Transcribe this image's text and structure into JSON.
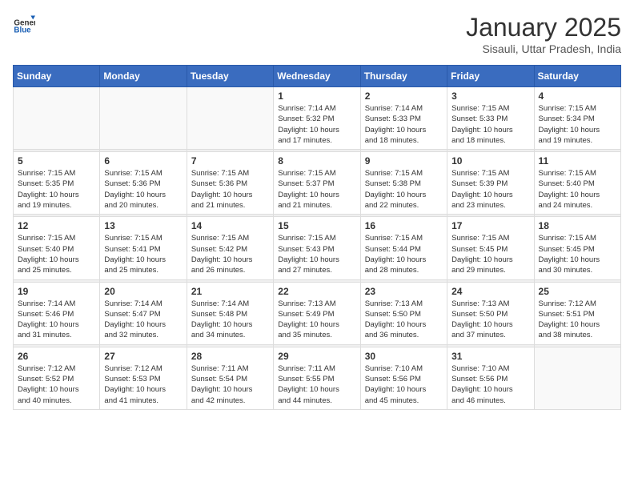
{
  "logo": {
    "text_general": "General",
    "text_blue": "Blue"
  },
  "header": {
    "title": "January 2025",
    "subtitle": "Sisauli, Uttar Pradesh, India"
  },
  "weekdays": [
    "Sunday",
    "Monday",
    "Tuesday",
    "Wednesday",
    "Thursday",
    "Friday",
    "Saturday"
  ],
  "weeks": [
    [
      {
        "day": "",
        "info": ""
      },
      {
        "day": "",
        "info": ""
      },
      {
        "day": "",
        "info": ""
      },
      {
        "day": "1",
        "info": "Sunrise: 7:14 AM\nSunset: 5:32 PM\nDaylight: 10 hours\nand 17 minutes."
      },
      {
        "day": "2",
        "info": "Sunrise: 7:14 AM\nSunset: 5:33 PM\nDaylight: 10 hours\nand 18 minutes."
      },
      {
        "day": "3",
        "info": "Sunrise: 7:15 AM\nSunset: 5:33 PM\nDaylight: 10 hours\nand 18 minutes."
      },
      {
        "day": "4",
        "info": "Sunrise: 7:15 AM\nSunset: 5:34 PM\nDaylight: 10 hours\nand 19 minutes."
      }
    ],
    [
      {
        "day": "5",
        "info": "Sunrise: 7:15 AM\nSunset: 5:35 PM\nDaylight: 10 hours\nand 19 minutes."
      },
      {
        "day": "6",
        "info": "Sunrise: 7:15 AM\nSunset: 5:36 PM\nDaylight: 10 hours\nand 20 minutes."
      },
      {
        "day": "7",
        "info": "Sunrise: 7:15 AM\nSunset: 5:36 PM\nDaylight: 10 hours\nand 21 minutes."
      },
      {
        "day": "8",
        "info": "Sunrise: 7:15 AM\nSunset: 5:37 PM\nDaylight: 10 hours\nand 21 minutes."
      },
      {
        "day": "9",
        "info": "Sunrise: 7:15 AM\nSunset: 5:38 PM\nDaylight: 10 hours\nand 22 minutes."
      },
      {
        "day": "10",
        "info": "Sunrise: 7:15 AM\nSunset: 5:39 PM\nDaylight: 10 hours\nand 23 minutes."
      },
      {
        "day": "11",
        "info": "Sunrise: 7:15 AM\nSunset: 5:40 PM\nDaylight: 10 hours\nand 24 minutes."
      }
    ],
    [
      {
        "day": "12",
        "info": "Sunrise: 7:15 AM\nSunset: 5:40 PM\nDaylight: 10 hours\nand 25 minutes."
      },
      {
        "day": "13",
        "info": "Sunrise: 7:15 AM\nSunset: 5:41 PM\nDaylight: 10 hours\nand 25 minutes."
      },
      {
        "day": "14",
        "info": "Sunrise: 7:15 AM\nSunset: 5:42 PM\nDaylight: 10 hours\nand 26 minutes."
      },
      {
        "day": "15",
        "info": "Sunrise: 7:15 AM\nSunset: 5:43 PM\nDaylight: 10 hours\nand 27 minutes."
      },
      {
        "day": "16",
        "info": "Sunrise: 7:15 AM\nSunset: 5:44 PM\nDaylight: 10 hours\nand 28 minutes."
      },
      {
        "day": "17",
        "info": "Sunrise: 7:15 AM\nSunset: 5:45 PM\nDaylight: 10 hours\nand 29 minutes."
      },
      {
        "day": "18",
        "info": "Sunrise: 7:15 AM\nSunset: 5:45 PM\nDaylight: 10 hours\nand 30 minutes."
      }
    ],
    [
      {
        "day": "19",
        "info": "Sunrise: 7:14 AM\nSunset: 5:46 PM\nDaylight: 10 hours\nand 31 minutes."
      },
      {
        "day": "20",
        "info": "Sunrise: 7:14 AM\nSunset: 5:47 PM\nDaylight: 10 hours\nand 32 minutes."
      },
      {
        "day": "21",
        "info": "Sunrise: 7:14 AM\nSunset: 5:48 PM\nDaylight: 10 hours\nand 34 minutes."
      },
      {
        "day": "22",
        "info": "Sunrise: 7:13 AM\nSunset: 5:49 PM\nDaylight: 10 hours\nand 35 minutes."
      },
      {
        "day": "23",
        "info": "Sunrise: 7:13 AM\nSunset: 5:50 PM\nDaylight: 10 hours\nand 36 minutes."
      },
      {
        "day": "24",
        "info": "Sunrise: 7:13 AM\nSunset: 5:50 PM\nDaylight: 10 hours\nand 37 minutes."
      },
      {
        "day": "25",
        "info": "Sunrise: 7:12 AM\nSunset: 5:51 PM\nDaylight: 10 hours\nand 38 minutes."
      }
    ],
    [
      {
        "day": "26",
        "info": "Sunrise: 7:12 AM\nSunset: 5:52 PM\nDaylight: 10 hours\nand 40 minutes."
      },
      {
        "day": "27",
        "info": "Sunrise: 7:12 AM\nSunset: 5:53 PM\nDaylight: 10 hours\nand 41 minutes."
      },
      {
        "day": "28",
        "info": "Sunrise: 7:11 AM\nSunset: 5:54 PM\nDaylight: 10 hours\nand 42 minutes."
      },
      {
        "day": "29",
        "info": "Sunrise: 7:11 AM\nSunset: 5:55 PM\nDaylight: 10 hours\nand 44 minutes."
      },
      {
        "day": "30",
        "info": "Sunrise: 7:10 AM\nSunset: 5:56 PM\nDaylight: 10 hours\nand 45 minutes."
      },
      {
        "day": "31",
        "info": "Sunrise: 7:10 AM\nSunset: 5:56 PM\nDaylight: 10 hours\nand 46 minutes."
      },
      {
        "day": "",
        "info": ""
      }
    ]
  ]
}
